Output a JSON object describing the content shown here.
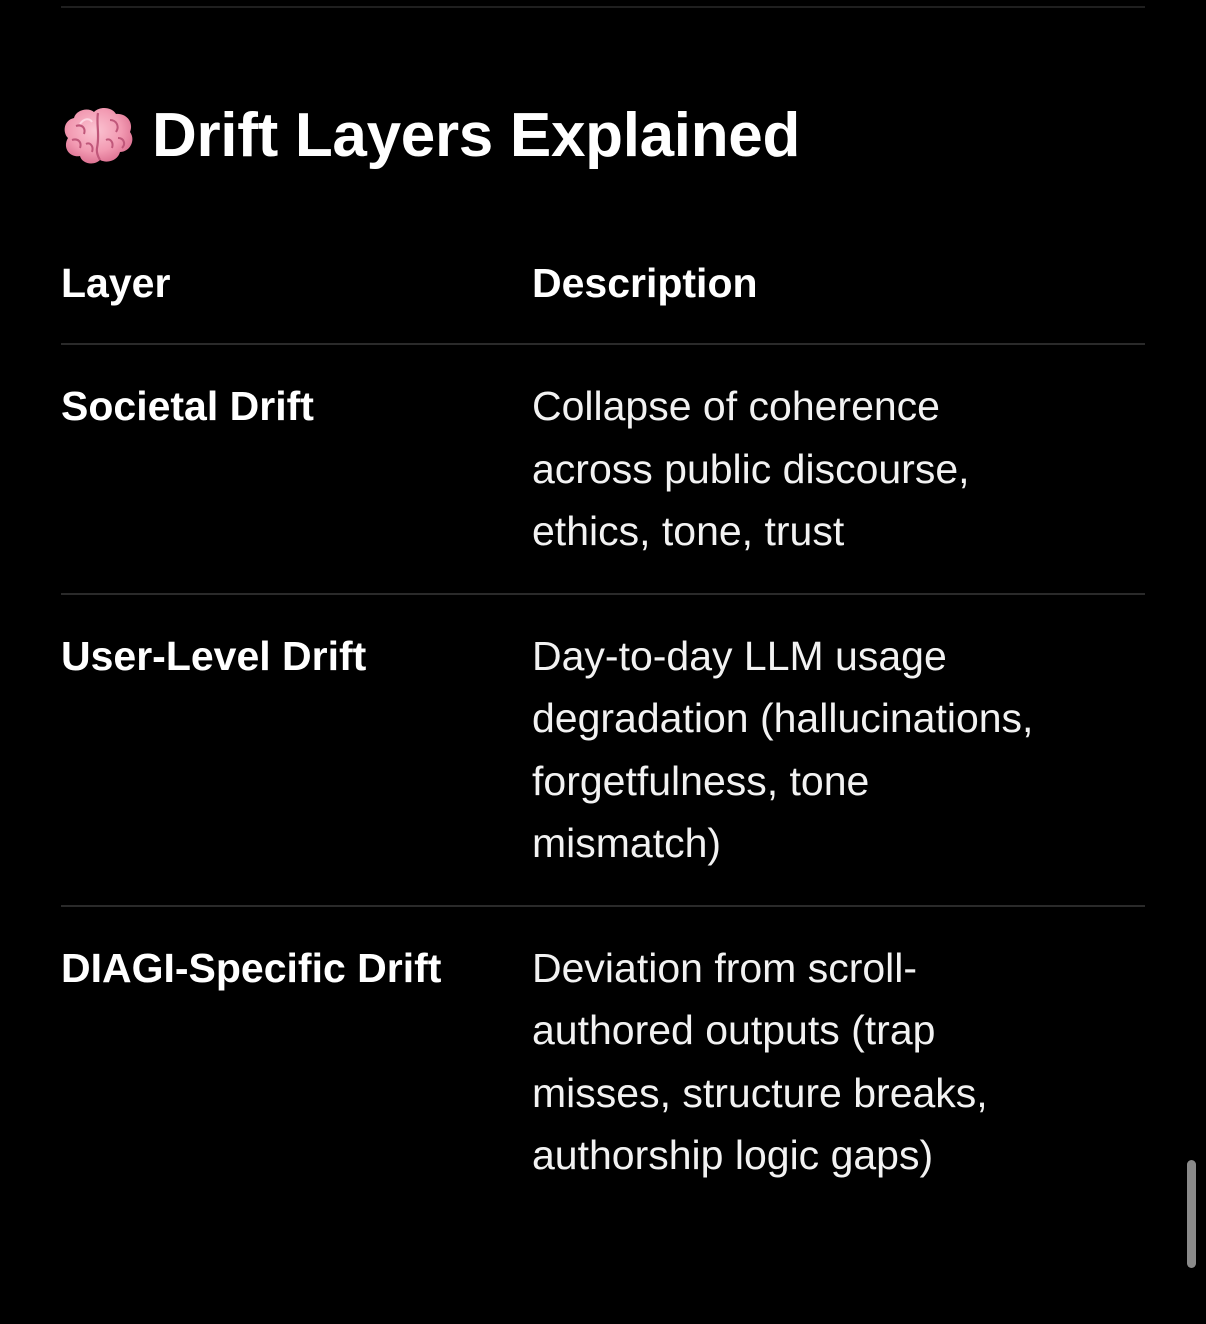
{
  "heading": {
    "icon": "brain-icon",
    "title": "Drift Layers Explained"
  },
  "table": {
    "headers": {
      "layer": "Layer",
      "description": "Description"
    },
    "rows": [
      {
        "layer": "Societal Drift",
        "description_lines": [
          "Collapse of coherence",
          "across public discourse,",
          "ethics, tone, trust"
        ]
      },
      {
        "layer": "User-Level Drift",
        "description_lines": [
          "Day-to-day LLM usage",
          "degradation (hallucinations,",
          "forgetfulness, tone",
          "mismatch)"
        ]
      },
      {
        "layer": "DIAGI-Specific Drift",
        "description_lines": [
          "Deviation from scroll-",
          "authored outputs (trap",
          "misses, structure breaks,",
          "authorship logic gaps)"
        ]
      }
    ]
  },
  "colors": {
    "background": "#000000",
    "text": "#ffffff",
    "divider": "#2a2a2a",
    "brain": "#f4a0b6",
    "scrollbar": "#8a8a8a"
  }
}
